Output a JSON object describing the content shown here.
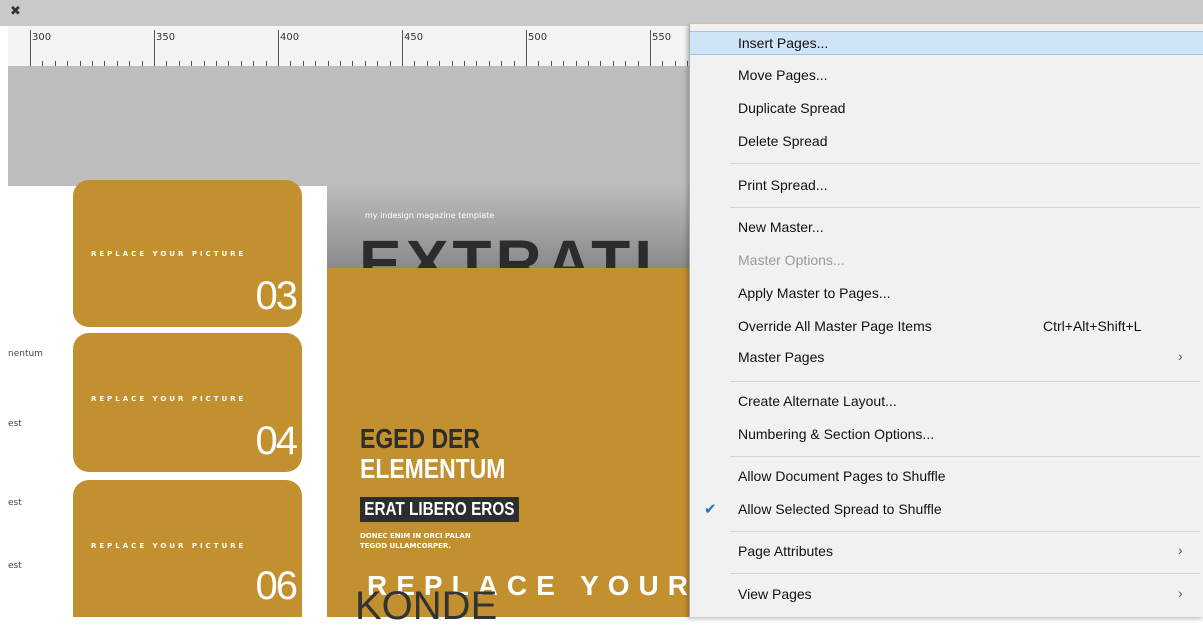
{
  "window": {
    "close_glyph": "✖"
  },
  "ruler": {
    "labels": [
      "300",
      "350",
      "400",
      "450",
      "500",
      "550"
    ]
  },
  "left_labels": [
    "nentum",
    "est",
    "est",
    "est"
  ],
  "thumbnails": [
    {
      "caption": "REPLACE YOUR PICTURE",
      "number": "03"
    },
    {
      "caption": "REPLACE YOUR PICTURE",
      "number": "04"
    },
    {
      "caption": "REPLACE YOUR PICTURE",
      "number": "06"
    }
  ],
  "cover": {
    "tagline": "my indesign magazine template",
    "masthead": "EXTRATI",
    "headline_1": "EGED DER",
    "headline_2": "ELEMENTUM",
    "headline_3": "ERAT LIBERO EROS",
    "subtext_1": "DONEC ENIM IN ORCI PALAN",
    "subtext_2": "TEGOD ULLAMCORPER.",
    "replace_text": "REPLACE YOUR PI",
    "bottom_word": "KONDE"
  },
  "colors": {
    "page_accent": "#c3902f",
    "menu_highlight": "#cfe4f7",
    "check_color": "#2a6fb5"
  },
  "context_menu": {
    "items": [
      {
        "label": "Insert Pages...",
        "state": "highlighted"
      },
      {
        "label": "Move Pages..."
      },
      {
        "label": "Duplicate Spread"
      },
      {
        "label": "Delete Spread"
      },
      {
        "label": "Print Spread..."
      },
      {
        "label": "New Master..."
      },
      {
        "label": "Master Options...",
        "state": "disabled"
      },
      {
        "label": "Apply Master to Pages..."
      },
      {
        "label": "Override All Master Page Items",
        "shortcut": "Ctrl+Alt+Shift+L"
      },
      {
        "label": "Master Pages",
        "submenu": true,
        "arrow": "›"
      },
      {
        "label": "Create Alternate Layout..."
      },
      {
        "label": "Numbering & Section Options..."
      },
      {
        "label": "Allow Document Pages to Shuffle"
      },
      {
        "label": "Allow Selected Spread to Shuffle",
        "checked": true,
        "check_glyph": "✔"
      },
      {
        "label": "Page Attributes",
        "submenu": true,
        "arrow": "›"
      },
      {
        "label": "View Pages",
        "submenu": true,
        "arrow": "›"
      }
    ]
  }
}
